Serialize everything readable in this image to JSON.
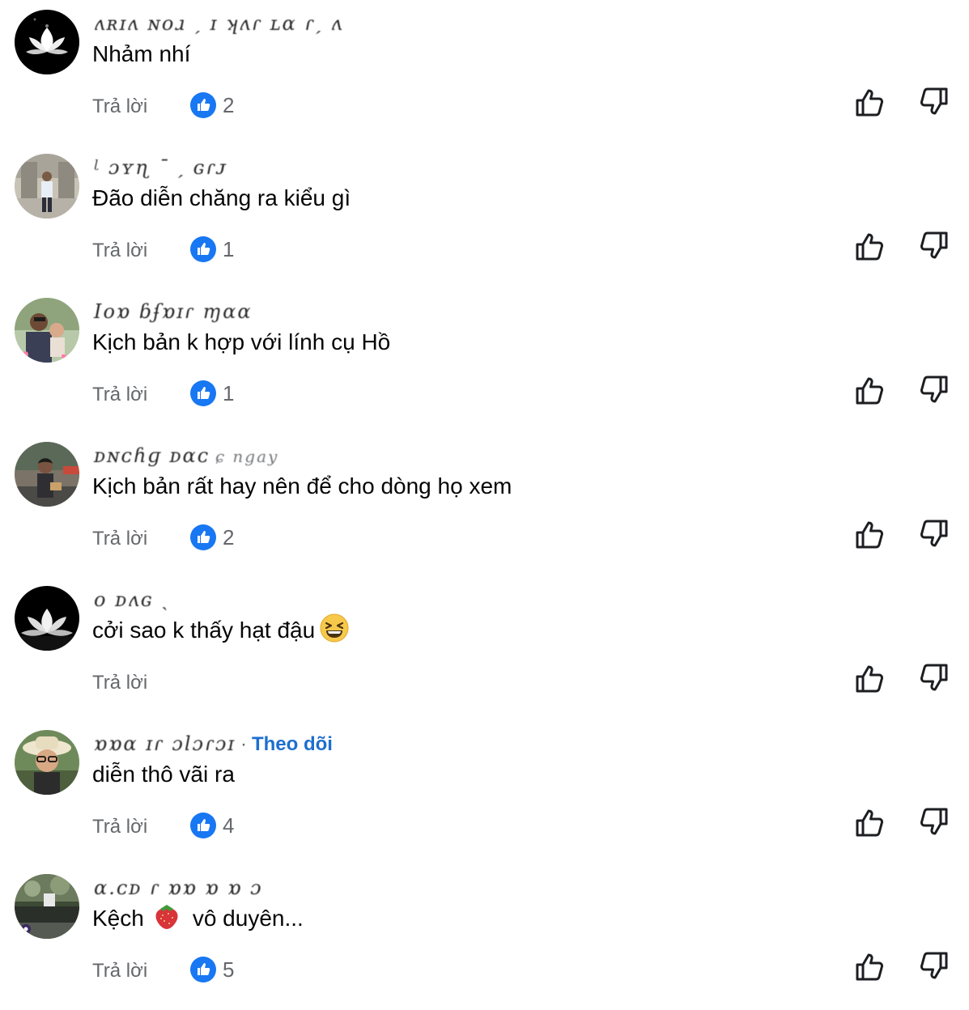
{
  "comments": [
    {
      "name": "ʌʀɪʌ ɴoɹ ˏ ɪ ʞʌɾ ʟɑ ɾˏ ʌ",
      "text": "Nhảm nhí",
      "reply": "Trả lời",
      "likes": "2",
      "emoji": "",
      "text_after": "",
      "follow": ""
    },
    {
      "name": "ᶩ ɔʏɳ ˉ ˏ ɢɾᴊ",
      "text": "Đão diễn chăng ra kiểu gì",
      "reply": "Trả lời",
      "likes": "1",
      "emoji": "",
      "text_after": "",
      "follow": ""
    },
    {
      "name": "Iᴏɒ ɓʄɒɪɾ ɱɑɑ",
      "text": "Kịch bản k hợp với lính cụ Hồ",
      "reply": "Trả lời",
      "likes": "1",
      "emoji": "",
      "text_after": "",
      "follow": ""
    },
    {
      "name": "ᴅɴᴄɦɡ ᴅɑᴄ",
      "name_tail": "ɕ ngay",
      "text": "Kịch bản rất hay nên để cho dòng họ xem",
      "reply": "Trả lời",
      "likes": "2",
      "emoji": "",
      "text_after": "",
      "follow": ""
    },
    {
      "name": "o ᴅʌɢ ˎ",
      "text": "cởi sao k thấy hạt đậu",
      "reply": "Trả lời",
      "likes": "",
      "emoji": "grinning-squint-emoji",
      "text_after": "",
      "follow": ""
    },
    {
      "name": "ɒɒɑ ɪɾ ɔlɔɾɔɪ",
      "text": "diễn thô vãi ra",
      "reply": "Trả lời",
      "likes": "4",
      "emoji": "",
      "text_after": "",
      "follow": "Theo dõi"
    },
    {
      "name": "ɑ.ᴄᴅ ɾ ɒɒ ɒ ɒ ɔ",
      "text": "Kệch",
      "reply": "Trả lời",
      "likes": "5",
      "emoji": "strawberry-emoji",
      "text_after": "vô duyên...",
      "follow": ""
    }
  ],
  "separator": "·",
  "colors": {
    "like_blue": "#1877f2",
    "follow_blue": "#1d6fcf",
    "meta_gray": "#65676b",
    "text": "#050505"
  }
}
